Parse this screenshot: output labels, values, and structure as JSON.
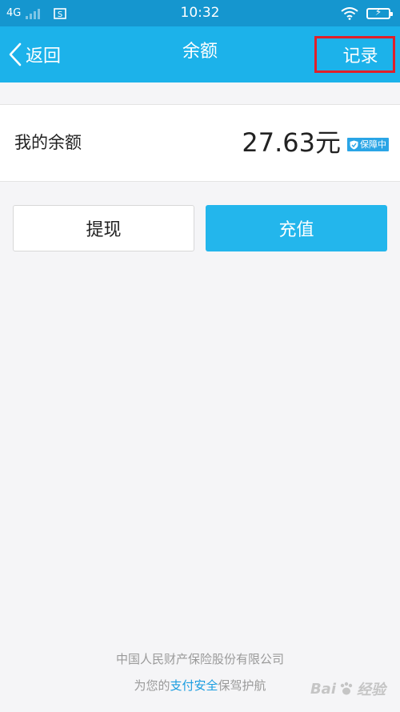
{
  "status_bar": {
    "network": "4G",
    "time": "10:32",
    "sim_icon": "sim-card-icon",
    "wifi_icon": "wifi-icon",
    "battery_icon": "battery-charging-icon"
  },
  "nav": {
    "back_label": "返回",
    "title": "余额",
    "record_label": "记录",
    "highlight_color": "#e0202a"
  },
  "balance": {
    "label": "我的余额",
    "amount": "27.63元",
    "badge": "保障中"
  },
  "actions": {
    "withdraw_label": "提现",
    "recharge_label": "充值"
  },
  "footer": {
    "company": "中国人民财产保险股份有限公司",
    "safety_prefix": "为您的",
    "safety_highlight": "支付安全",
    "safety_suffix": "保驾护航"
  },
  "watermark": {
    "logo_text": "Bai",
    "logo_suffix": "经验"
  },
  "colors": {
    "status_bar": "#1596cf",
    "nav_bar": "#1cb2ea",
    "primary_button": "#23b6ec",
    "badge": "#2aa5e6"
  }
}
